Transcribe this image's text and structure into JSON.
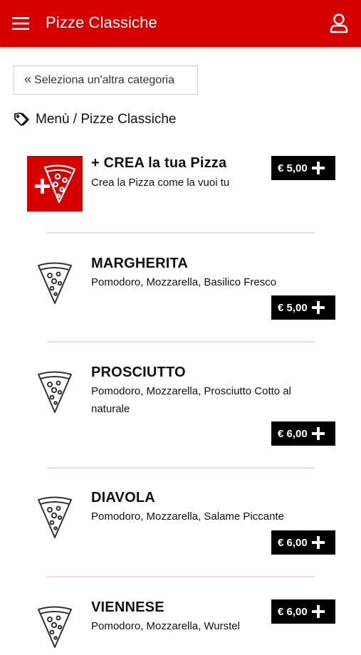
{
  "header": {
    "title": "Pizze Classiche",
    "menu_icon": "hamburger-menu-icon",
    "user_icon": "user-icon",
    "brand_color": "#d60000"
  },
  "back_button": {
    "icon": "double-chevron-left-icon",
    "label": "Seleziona un'altra categoria"
  },
  "breadcrumb": {
    "icon": "tag-icon",
    "text": "Menù / Pizze Classiche"
  },
  "items": [
    {
      "name": "+ CREA la tua Pizza",
      "description": "Crea la Pizza come la vuoi tu",
      "price": "€ 5,00",
      "icon": "create-pizza-slice-icon"
    },
    {
      "name": "MARGHERITA",
      "description": "Pomodoro, Mozzarella, Basilico Fresco",
      "price": "€ 5,00",
      "icon": "pizza-slice-icon"
    },
    {
      "name": "PROSCIUTTO",
      "description": "Pomodoro, Mozzarella, Prosciutto Cotto al naturale",
      "price": "€ 6,00",
      "icon": "pizza-slice-icon"
    },
    {
      "name": "DIAVOLA",
      "description": "Pomodoro, Mozzarella, Salame Piccante",
      "price": "€ 6,00",
      "icon": "pizza-slice-icon"
    },
    {
      "name": "VIENNESE",
      "description": "Pomodoro, Mozzarella, Wurstel",
      "price": "€ 6,00",
      "icon": "pizza-slice-icon"
    }
  ]
}
